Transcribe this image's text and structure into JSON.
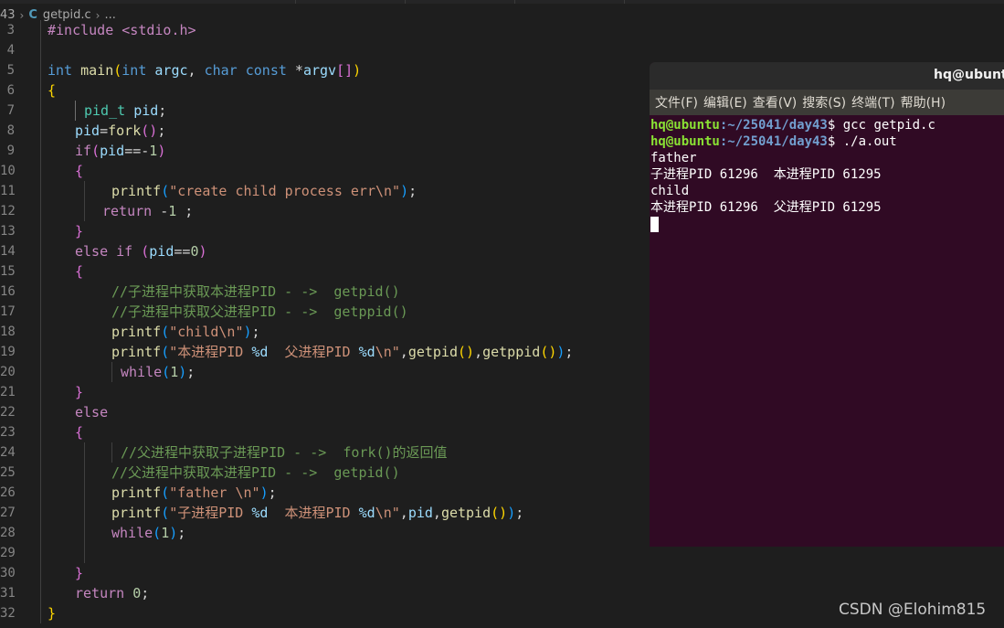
{
  "breadcrumb": {
    "prefix": "43",
    "file_icon": "C",
    "file": "getpid.c",
    "ellipsis": "..."
  },
  "editor": {
    "line_numbers": [
      "3",
      "4",
      "5",
      "6",
      "7",
      "8",
      "9",
      "10",
      "11",
      "12",
      "13",
      "14",
      "15",
      "16",
      "17",
      "18",
      "19",
      "20",
      "21",
      "22",
      "23",
      "24",
      "25",
      "26",
      "27",
      "28",
      "29",
      "30",
      "31",
      "32"
    ],
    "l3": "#include <stdio.h>",
    "l5": {
      "int1": "int",
      "main": "main",
      "p1": "(",
      "int2": "int",
      "argc": "argc",
      "comma1": ", ",
      "char": "char",
      "const": "const",
      "star": " *",
      "argv": "argv",
      "br": "[]",
      "p2": ")"
    },
    "l6": "{",
    "l7": {
      "type": "pid_t",
      "var": "pid",
      "semi": ";"
    },
    "l8": {
      "var": "pid",
      "eq": "=",
      "fn": "fork",
      "p": "()",
      "semi": ";"
    },
    "l9": {
      "kw": "if",
      "p1": "(",
      "var": "pid",
      "op": "==-",
      "num": "1",
      "p2": ")"
    },
    "l10": "{",
    "l11": {
      "fn": "printf",
      "p1": "(",
      "str": "\"create child process err\\n\"",
      "p2": ")",
      "semi": ";"
    },
    "l12": {
      "kw": "return",
      "rest": " -",
      "num": "1",
      "semi": " ;"
    },
    "l13": "}",
    "l14": {
      "kw1": "else",
      "kw2": "if",
      "p1": "(",
      "var": "pid",
      "op": "==",
      "num": "0",
      "p2": ")"
    },
    "l15": "{",
    "l16": "//子进程中获取本进程PID - ->  getpid()",
    "l17": "//子进程中获取父进程PID - ->  getppid()",
    "l18": {
      "fn": "printf",
      "p1": "(",
      "str": "\"child\\n\"",
      "p2": ")",
      "semi": ";"
    },
    "l19": {
      "fn": "printf",
      "p1": "(",
      "str1": "\"本进程PID ",
      "fmt1": "%d",
      "str2": "  父进程PID ",
      "fmt2": "%d",
      "str3": "\\n\"",
      "comma1": ",",
      "fn2": "getpid",
      "p3": "()",
      "comma2": ",",
      "fn3": "getppid",
      "p4": "()",
      "p2": ")",
      "semi": ";"
    },
    "l20": {
      "kw": "while",
      "p1": "(",
      "num": "1",
      "p2": ")",
      "semi": ";"
    },
    "l21": "}",
    "l22": "else",
    "l23": "{",
    "l24": "//父进程中获取子进程PID - ->  fork()的返回值",
    "l25": "//父进程中获取本进程PID - ->  getpid()",
    "l26": {
      "fn": "printf",
      "p1": "(",
      "str": "\"father \\n\"",
      "p2": ")",
      "semi": ";"
    },
    "l27": {
      "fn": "printf",
      "p1": "(",
      "str1": "\"子进程PID ",
      "fmt1": "%d",
      "str2": "  本进程PID ",
      "fmt2": "%d",
      "str3": "\\n\"",
      "comma1": ",",
      "var": "pid",
      "comma2": ",",
      "fn2": "getpid",
      "p3": "()",
      "p2": ")",
      "semi": ";"
    },
    "l28": {
      "kw": "while",
      "p1": "(",
      "num": "1",
      "p2": ")",
      "semi": ";"
    },
    "l30": "}",
    "l31": {
      "kw": "return",
      "num": "0",
      "semi": ";"
    },
    "l32": "}"
  },
  "terminal": {
    "title": "hq@ubuntu",
    "menu": [
      "文件(F)",
      "编辑(E)",
      "查看(V)",
      "搜索(S)",
      "终端(T)",
      "帮助(H)"
    ],
    "prompt_user": "hq@ubuntu",
    "prompt_path": ":~/25041/day43",
    "cmd1": "$ gcc getpid.c",
    "cmd2": "$ ./a.out",
    "out1": "father",
    "out2": "子进程PID 61296  本进程PID 61295",
    "out3": "child",
    "out4": "本进程PID 61296  父进程PID 61295",
    "colors": {
      "bg": "#300a24",
      "user": "#8ae234",
      "path": "#729fcf"
    }
  },
  "watermark": "CSDN @Elohim815"
}
